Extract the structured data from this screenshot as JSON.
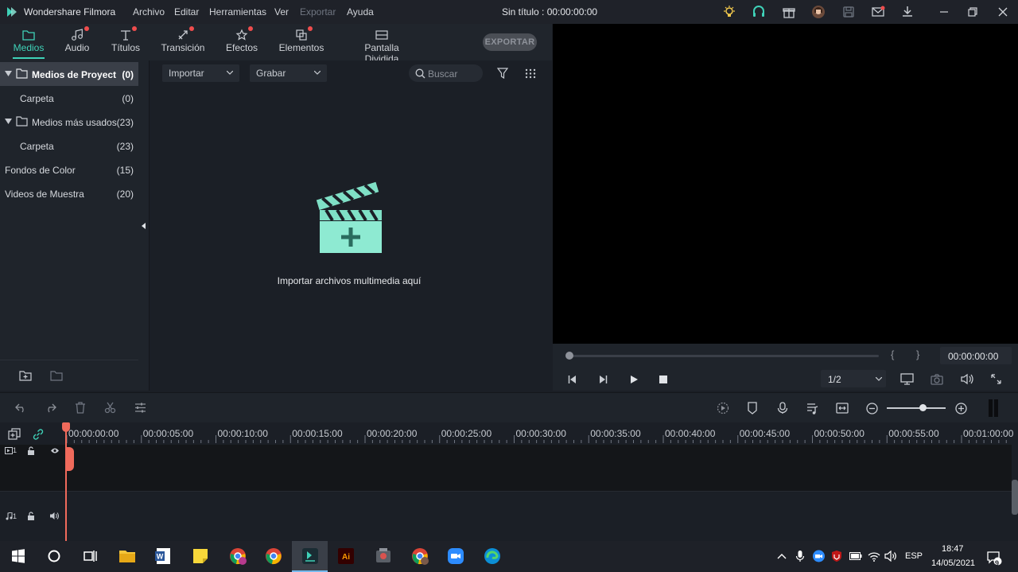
{
  "app": {
    "name": "Wondershare Filmora",
    "document_title": "Sin título : 00:00:00:00"
  },
  "menu": [
    "Archivo",
    "Editar",
    "Herramientas",
    "Ver",
    "Exportar",
    "Ayuda"
  ],
  "tabs": [
    {
      "label": "Medios",
      "icon": "folder-icon",
      "active": true,
      "badge": false
    },
    {
      "label": "Audio",
      "icon": "music-icon",
      "active": false,
      "badge": true
    },
    {
      "label": "Títulos",
      "icon": "text-icon",
      "active": false,
      "badge": true
    },
    {
      "label": "Transición",
      "icon": "transition-icon",
      "active": false,
      "badge": true
    },
    {
      "label": "Efectos",
      "icon": "effects-icon",
      "active": false,
      "badge": true
    },
    {
      "label": "Elementos",
      "icon": "elements-icon",
      "active": false,
      "badge": true
    },
    {
      "label": "Pantalla Dividida",
      "icon": "split-screen-icon",
      "active": false,
      "badge": false
    }
  ],
  "export_label": "EXPORTAR",
  "library": [
    {
      "name": "Medios de Proyect",
      "count": "(0)",
      "expandable": true,
      "selected": true
    },
    {
      "name": "Carpeta",
      "count": "(0)",
      "expandable": false,
      "selected": false
    },
    {
      "name": "Medios más usados",
      "count": "(23)",
      "expandable": true,
      "selected": false
    },
    {
      "name": "Carpeta",
      "count": "(23)",
      "expandable": false,
      "selected": false
    },
    {
      "name": "Fondos de Color",
      "count": "(15)",
      "expandable": false,
      "selected": false
    },
    {
      "name": "Videos de Muestra",
      "count": "(20)",
      "expandable": false,
      "selected": false
    }
  ],
  "media_toolbar": {
    "import_label": "Importar",
    "record_label": "Grabar",
    "search_placeholder": "Buscar"
  },
  "import_message": "Importar archivos multimedia aquí",
  "preview": {
    "timecode": "00:00:00:00",
    "quality": "1/2",
    "mark_in": "{",
    "mark_out": "}"
  },
  "timeline": {
    "ticks": [
      "00:00:00:00",
      "00:00:05:00",
      "00:00:10:00",
      "00:00:15:00",
      "00:00:20:00",
      "00:00:25:00",
      "00:00:30:00",
      "00:00:35:00",
      "00:00:40:00",
      "00:00:45:00",
      "00:00:50:00",
      "00:00:55:00",
      "00:01:00:00"
    ],
    "video_track_label": "1",
    "audio_track_label": "1"
  },
  "taskbar": {
    "language": "ESP",
    "time": "18:47",
    "date": "14/05/2021",
    "notifications": "9"
  },
  "colors": {
    "accent": "#3fd2b8",
    "badge": "#ef4d4d",
    "playhead": "#f06a5b"
  }
}
